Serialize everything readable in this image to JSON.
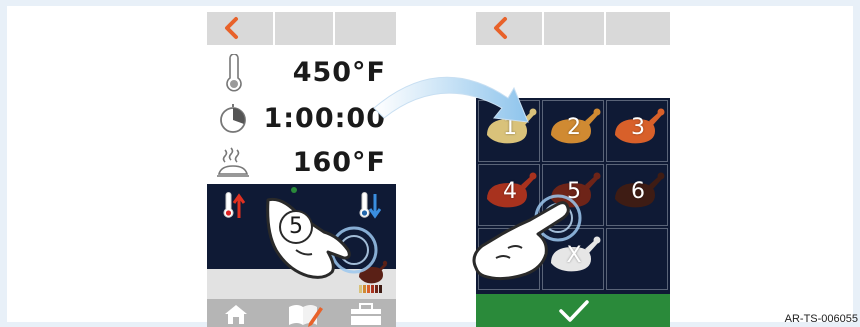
{
  "left_screen": {
    "temperature": "450°F",
    "time": "1:00:00",
    "probe_temperature": "160°F",
    "step_badge": "5",
    "icons": {
      "back": "chevron-left-icon",
      "thermometer": "thermometer-icon",
      "timer": "timer-icon",
      "probe": "steam-food-icon",
      "temp_up": "thermometer-up-icon",
      "temp_down": "thermometer-down-icon",
      "doneness": "chicken-doneness-icon",
      "home": "home-icon",
      "recipe": "recipe-edit-icon",
      "toolbox": "toolbox-icon"
    }
  },
  "right_screen": {
    "doneness_levels": [
      {
        "label": "1",
        "color": "#d9c27a"
      },
      {
        "label": "2",
        "color": "#d08a32"
      },
      {
        "label": "3",
        "color": "#d8602a"
      },
      {
        "label": "4",
        "color": "#a8321e"
      },
      {
        "label": "5",
        "color": "#6e2418"
      },
      {
        "label": "6",
        "color": "#3e1c14"
      }
    ],
    "cancel_label": "X",
    "icons": {
      "back": "chevron-left-icon",
      "confirm": "checkmark-icon"
    }
  },
  "colors": {
    "accent_orange": "#e8622a",
    "dark_panel": "#0f1a35",
    "confirm_green": "#2a8a3a",
    "header_gray": "#d9d9d9",
    "arrow_blue": "#8ec4ec"
  },
  "reference_code": "AR-TS-006055"
}
